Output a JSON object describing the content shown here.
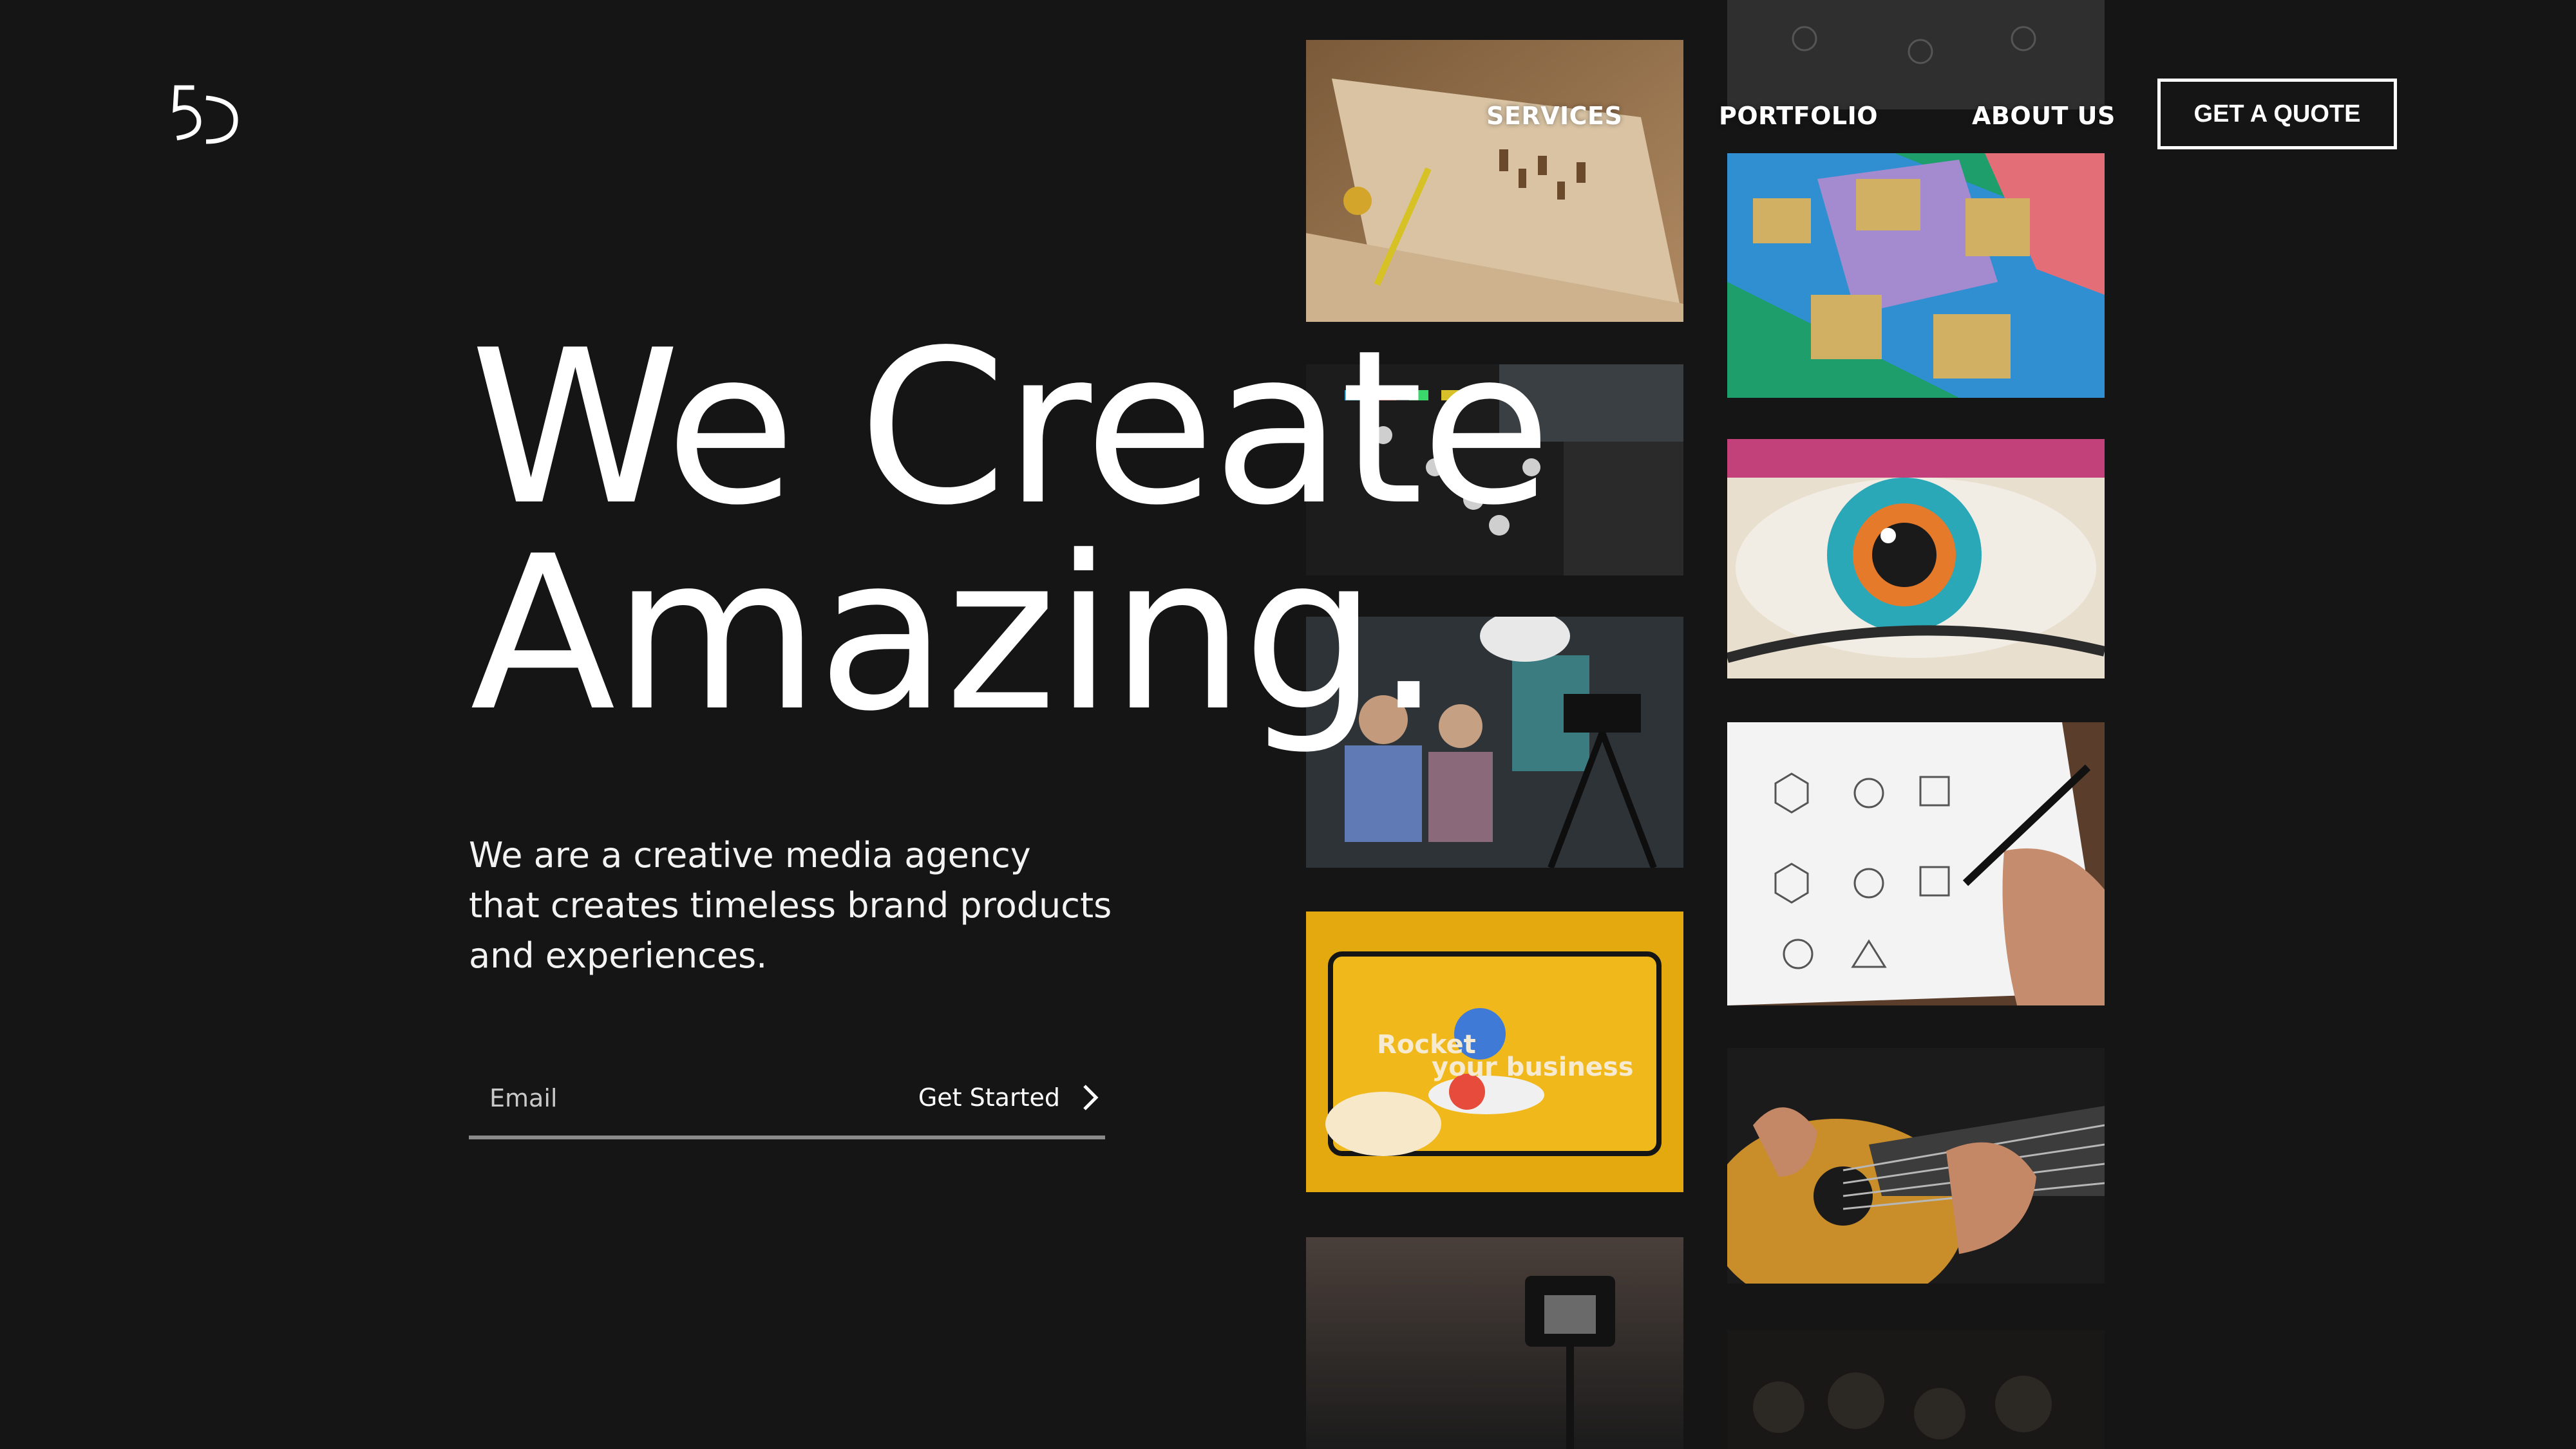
{
  "brand": {
    "logo_text": "5D"
  },
  "nav": {
    "links": [
      {
        "label": "SERVICES"
      },
      {
        "label": "PORTFOLIO"
      },
      {
        "label": "ABOUT US"
      }
    ],
    "cta_label": "GET A QUOTE"
  },
  "hero": {
    "headline_line1": "We Create",
    "headline_line2": "Amazing.",
    "tagline_lines": [
      "We are a creative media agency",
      "that creates timeless brand products",
      "and experiences."
    ],
    "email_placeholder": "Email",
    "submit_label": "Get Started"
  },
  "gallery": {
    "tiles": [
      {
        "name": "wooden-workbench-photo"
      },
      {
        "name": "audio-mixer-photo"
      },
      {
        "name": "video-interview-set-photo"
      },
      {
        "name": "rocket-website-mockup",
        "mock_title_1": "Rocket",
        "mock_title_2": "your business"
      },
      {
        "name": "camera-on-tripod-photo"
      },
      {
        "name": "drawing-sketches-photo-top"
      },
      {
        "name": "boxes-on-colors-photo"
      },
      {
        "name": "painted-eye-photo"
      },
      {
        "name": "hand-drawing-icons-photo"
      },
      {
        "name": "guitar-playing-photo"
      },
      {
        "name": "dark-crowd-photo"
      }
    ]
  },
  "colors": {
    "background": "#151515",
    "text": "#ffffff",
    "underline": "#8a8a8a"
  }
}
